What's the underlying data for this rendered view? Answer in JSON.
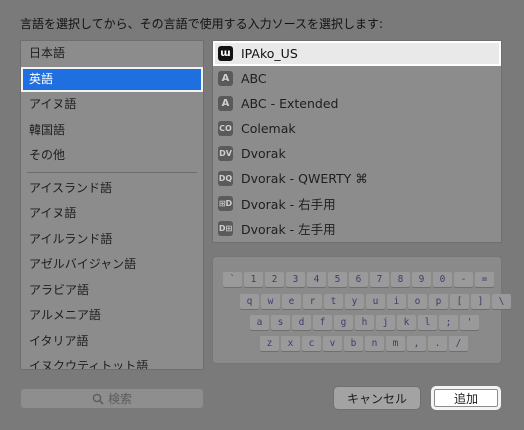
{
  "instruction": "言語を選択してから、その言語で使用する入力ソースを選択します:",
  "languages_top": [
    {
      "label": "日本語",
      "selected": false
    },
    {
      "label": "英語",
      "selected": true
    },
    {
      "label": "アイヌ語",
      "selected": false
    },
    {
      "label": "韓国語",
      "selected": false
    },
    {
      "label": "その他",
      "selected": false
    }
  ],
  "languages_rest": [
    {
      "label": "アイスランド語"
    },
    {
      "label": "アイヌ語"
    },
    {
      "label": "アイルランド語"
    },
    {
      "label": "アゼルバイジャン語"
    },
    {
      "label": "アラビア語"
    },
    {
      "label": "アルメニア語"
    },
    {
      "label": "イタリア語"
    },
    {
      "label": "イヌクウティトット語"
    }
  ],
  "sources": [
    {
      "label": "IPAko_US",
      "icon_text": "ɯ",
      "icon": "ipako-icon",
      "selected": true
    },
    {
      "label": "ABC",
      "icon_text": "A",
      "icon": "abc-icon",
      "selected": false
    },
    {
      "label": "ABC - Extended",
      "icon_text": "A",
      "icon": "abc-extended-icon",
      "selected": false
    },
    {
      "label": "Colemak",
      "icon_text": "CO",
      "icon": "colemak-icon",
      "selected": false
    },
    {
      "label": "Dvorak",
      "icon_text": "DV",
      "icon": "dvorak-icon",
      "selected": false
    },
    {
      "label": "Dvorak - QWERTY ⌘",
      "icon_text": "DQ",
      "icon": "dvorak-qwerty-icon",
      "selected": false
    },
    {
      "label": "Dvorak - 右手用",
      "icon_text": "⊞D",
      "icon": "dvorak-right-icon",
      "selected": false
    },
    {
      "label": "Dvorak - 左手用",
      "icon_text": "D⊞",
      "icon": "dvorak-left-icon",
      "selected": false
    }
  ],
  "keyboard": {
    "row1": [
      "`",
      "1",
      "2",
      "3",
      "4",
      "5",
      "6",
      "7",
      "8",
      "9",
      "0",
      "-",
      "="
    ],
    "row2": [
      "q",
      "w",
      "e",
      "r",
      "t",
      "y",
      "u",
      "i",
      "o",
      "p",
      "[",
      "]",
      "\\"
    ],
    "row3": [
      "a",
      "s",
      "d",
      "f",
      "g",
      "h",
      "j",
      "k",
      "l",
      ";",
      "'"
    ],
    "row4": [
      "z",
      "x",
      "c",
      "v",
      "b",
      "n",
      "m",
      ",",
      ".",
      "/"
    ]
  },
  "search": {
    "placeholder": "検索",
    "icon": "search-icon"
  },
  "buttons": {
    "cancel": "キャンセル",
    "add": "追加"
  },
  "colors": {
    "selection": "#1f6fe0",
    "background": "#7a7a7a"
  }
}
